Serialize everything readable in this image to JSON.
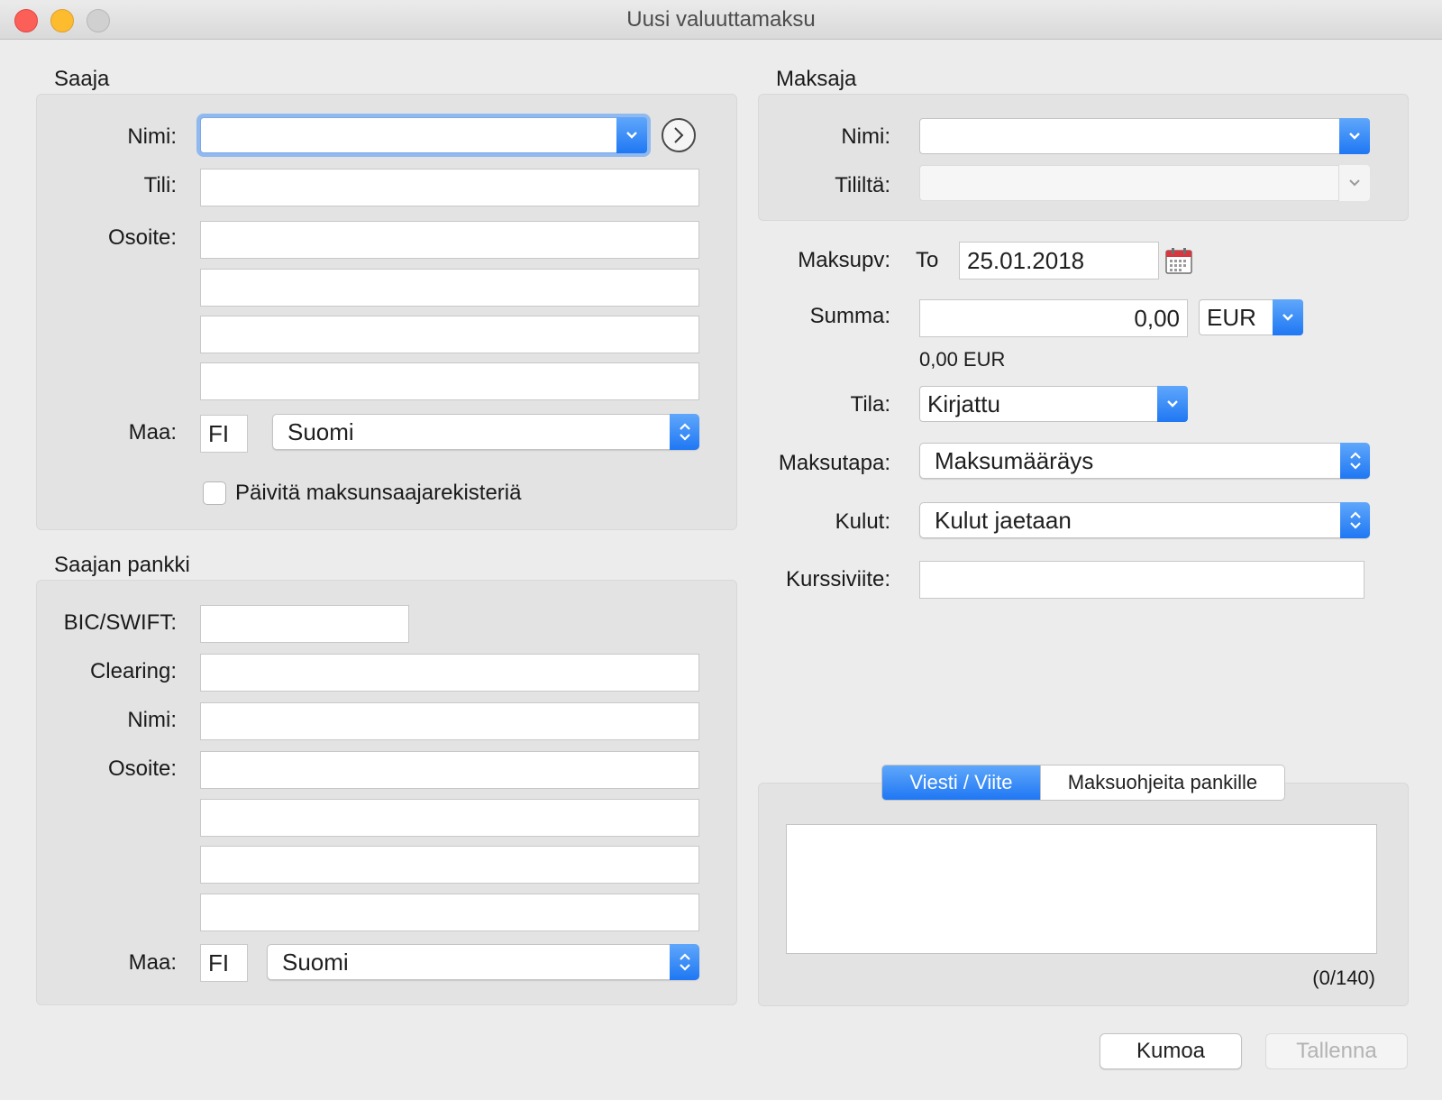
{
  "window": {
    "title": "Uusi valuuttamaksu"
  },
  "payee": {
    "section_title": "Saaja",
    "name_label": "Nimi:",
    "name_value": "",
    "account_label": "Tili:",
    "account_value": "",
    "address_label": "Osoite:",
    "address_lines": [
      "",
      "",
      "",
      ""
    ],
    "country_label": "Maa:",
    "country_code": "FI",
    "country_name": "Suomi",
    "update_register_label": "Päivitä maksunsaajarekisteriä",
    "update_register_checked": false
  },
  "payee_bank": {
    "section_title": "Saajan pankki",
    "bic_label": "BIC/SWIFT:",
    "bic_value": "",
    "clearing_label": "Clearing:",
    "clearing_value": "",
    "name_label": "Nimi:",
    "name_value": "",
    "address_label": "Osoite:",
    "address_lines": [
      "",
      "",
      "",
      ""
    ],
    "country_label": "Maa:",
    "country_code": "FI",
    "country_name": "Suomi"
  },
  "payer": {
    "section_title": "Maksaja",
    "name_label": "Nimi:",
    "name_value": "",
    "from_account_label": "Tililtä:",
    "from_account_value": ""
  },
  "payment": {
    "date_label": "Maksupv:",
    "weekday": "To",
    "date_value": "25.01.2018",
    "amount_label": "Summa:",
    "amount_value": "0,00",
    "currency": "EUR",
    "amount_summary": "0,00 EUR",
    "status_label": "Tila:",
    "status_value": "Kirjattu",
    "method_label": "Maksutapa:",
    "method_value": "Maksumääräys",
    "costs_label": "Kulut:",
    "costs_value": "Kulut jaetaan",
    "rate_ref_label": "Kurssiviite:",
    "rate_ref_value": ""
  },
  "message": {
    "tabs": [
      {
        "label": "Viesti / Viite",
        "selected": true
      },
      {
        "label": "Maksuohjeita pankille",
        "selected": false
      }
    ],
    "text": "",
    "char_count": "(0/140)"
  },
  "buttons": {
    "cancel": "Kumoa",
    "save": "Tallenna"
  },
  "colors": {
    "accent": "#1f77f3",
    "window_bg": "#ececec"
  }
}
